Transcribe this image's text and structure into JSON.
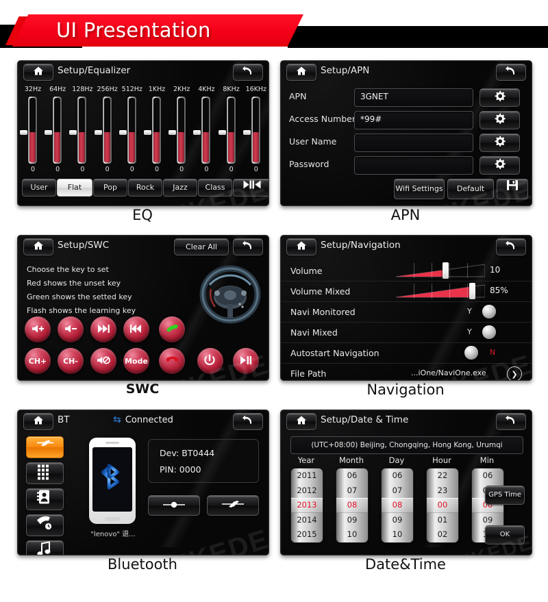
{
  "header": {
    "title": "UI Presentation",
    "banner_color": "#f40018"
  },
  "watermark": "MEKEDE",
  "panels": {
    "eq": {
      "caption": "EQ",
      "title": "Setup/Equalizer",
      "home_icon": "home-icon",
      "back_icon": "back-arrow-icon",
      "bands": [
        {
          "freq": "32Hz",
          "value": "0"
        },
        {
          "freq": "64Hz",
          "value": "0"
        },
        {
          "freq": "128Hz",
          "value": "0"
        },
        {
          "freq": "256Hz",
          "value": "0"
        },
        {
          "freq": "512Hz",
          "value": "0"
        },
        {
          "freq": "1KHz",
          "value": "0"
        },
        {
          "freq": "2KHz",
          "value": "0"
        },
        {
          "freq": "4KHz",
          "value": "0"
        },
        {
          "freq": "8KHz",
          "value": "0"
        },
        {
          "freq": "16KHz",
          "value": "0"
        }
      ],
      "presets": [
        {
          "label": "User",
          "active": false
        },
        {
          "label": "Flat",
          "active": true
        },
        {
          "label": "Pop",
          "active": false
        },
        {
          "label": "Rock",
          "active": false
        },
        {
          "label": "Jazz",
          "active": false
        },
        {
          "label": "Class",
          "active": false
        }
      ],
      "nav_button_icon": "prev-next-icon"
    },
    "apn": {
      "caption": "APN",
      "title": "Setup/APN",
      "fields": [
        {
          "label": "APN",
          "value": "3GNET",
          "gear_icon": "gear-icon"
        },
        {
          "label": "Access Number",
          "value": "*99#",
          "gear_icon": "gear-icon"
        },
        {
          "label": "User Name",
          "value": "",
          "gear_icon": "gear-icon"
        },
        {
          "label": "Password",
          "value": "",
          "gear_icon": "gear-icon"
        }
      ],
      "buttons": [
        {
          "label": "Wifi Settings"
        },
        {
          "label": "Default"
        }
      ],
      "save_icon": "floppy-save-icon"
    },
    "swc": {
      "caption": "SWC",
      "title": "Setup/SWC",
      "clear_all": "Clear All",
      "instructions": [
        "Choose the key to set",
        "Red shows the unset key",
        "Green shows the setted key",
        "Flash shows the learning key"
      ],
      "wheel_icon": "steering-wheel-icon",
      "keys_row1": [
        {
          "name": "volume-up-key",
          "icon": "speaker-plus-icon",
          "label": ""
        },
        {
          "name": "volume-down-key",
          "icon": "speaker-minus-icon",
          "label": ""
        },
        {
          "name": "next-track-key",
          "icon": "next-icon",
          "label": ""
        },
        {
          "name": "prev-track-key",
          "icon": "prev-icon",
          "label": ""
        },
        {
          "name": "answer-call-key",
          "icon": "phone-answer-icon",
          "label": ""
        }
      ],
      "keys_row2": [
        {
          "name": "channel-up-key",
          "icon": "",
          "label": "CH+"
        },
        {
          "name": "channel-down-key",
          "icon": "",
          "label": "CH-"
        },
        {
          "name": "mute-key",
          "icon": "speaker-mute-icon",
          "label": ""
        },
        {
          "name": "mode-key",
          "icon": "",
          "label": "Mode"
        },
        {
          "name": "hangup-call-key",
          "icon": "phone-hangup-icon",
          "label": ""
        },
        {
          "name": "power-key",
          "icon": "power-icon",
          "label": ""
        },
        {
          "name": "play-pause-key",
          "icon": "play-pause-icon",
          "label": ""
        }
      ]
    },
    "navigation": {
      "caption": "Navigation",
      "title": "Setup/Navigation",
      "rows": [
        {
          "label": "Volume",
          "type": "slider",
          "value": "10",
          "fill_pct": 55
        },
        {
          "label": "Volume Mixed",
          "type": "slider",
          "value": "85%",
          "fill_pct": 85
        },
        {
          "label": "Navi Monitored",
          "type": "toggle",
          "value": "Y",
          "value_color": "#e0e0e0"
        },
        {
          "label": "Navi Mixed",
          "type": "toggle",
          "value": "Y",
          "value_color": "#e0e0e0"
        },
        {
          "label": "Autostart Navigation",
          "type": "toggle",
          "value": "N",
          "value_color": "#d9192c"
        },
        {
          "label": "File Path",
          "type": "path",
          "value": "...iOne/NaviOne.exe",
          "arrow_icon": "chevron-right-icon"
        }
      ]
    },
    "bluetooth": {
      "caption": "Bluetooth",
      "title": "BT",
      "status": "Connected",
      "status_icon": "bt-exchange-icon",
      "sidebar": [
        {
          "name": "bt-connect-tab",
          "icon": "bt-link-icon",
          "active": true
        },
        {
          "name": "bt-keypad-tab",
          "icon": "keypad-icon",
          "active": false
        },
        {
          "name": "bt-contacts-tab",
          "icon": "contacts-icon",
          "active": false
        },
        {
          "name": "bt-calllog-tab",
          "icon": "call-history-icon",
          "active": false
        },
        {
          "name": "bt-music-tab",
          "icon": "music-note-icon",
          "active": false
        }
      ],
      "phone_label": "\"lenovo\" 退...",
      "phone_icon": "bluetooth-logo-icon",
      "device": "Dev: BT0444",
      "pin": "PIN: 0000",
      "actions": [
        {
          "name": "bt-disconnect-button",
          "icon": "disconnect-icon"
        },
        {
          "name": "bt-connect-button",
          "icon": "connect-icon"
        }
      ]
    },
    "datetime": {
      "caption": "Date&Time",
      "title": "Setup/Date & Time",
      "timezone": "(UTC+08:00) Beijing, Chongqing, Hong Kong, Urumqi",
      "columns": [
        {
          "head": "Year",
          "values": [
            "2011",
            "2012",
            "2013",
            "2014",
            "2015"
          ],
          "selected": 2
        },
        {
          "head": "Month",
          "values": [
            "06",
            "07",
            "08",
            "09",
            "10"
          ],
          "selected": 2
        },
        {
          "head": "Day",
          "values": [
            "06",
            "07",
            "08",
            "09",
            "10"
          ],
          "selected": 2
        },
        {
          "head": "Hour",
          "values": [
            "22",
            "23",
            "00",
            "01",
            "02"
          ],
          "selected": 2
        },
        {
          "head": "Min",
          "values": [
            "06",
            "07",
            "08",
            "09",
            "10"
          ],
          "selected": 2
        }
      ],
      "gps_button": "GPS Time",
      "ok_button": "OK"
    }
  }
}
